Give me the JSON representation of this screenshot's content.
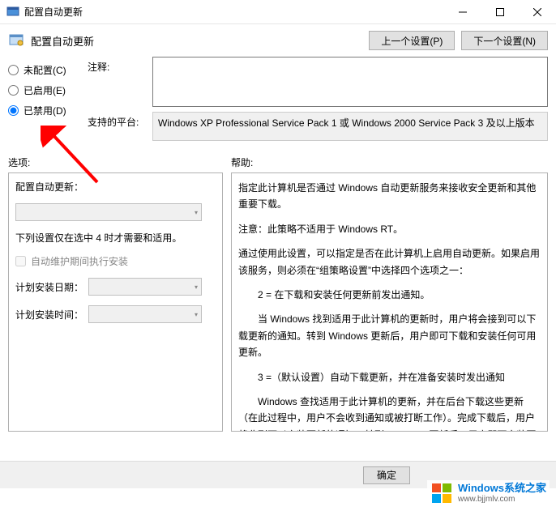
{
  "window": {
    "title": "配置自动更新"
  },
  "toolbar": {
    "title": "配置自动更新",
    "prev": "上一个设置(P)",
    "next": "下一个设置(N)"
  },
  "radios": {
    "not_configured": "未配置(C)",
    "enabled": "已启用(E)",
    "disabled": "已禁用(D)",
    "selected": "disabled"
  },
  "form": {
    "comment_label": "注释:",
    "comment_value": "",
    "platform_label": "支持的平台:",
    "platform_value": "Windows XP Professional Service Pack 1 或 Windows 2000 Service Pack 3 及以上版本"
  },
  "section": {
    "options_label": "选项:",
    "help_label": "帮助:"
  },
  "options": {
    "heading": "配置自动更新：",
    "note": "下列设置仅在选中 4 时才需要和适用。",
    "maintenance_chk": "自动维护期间执行安装",
    "sched_date": "计划安装日期：",
    "sched_time": "计划安装时间："
  },
  "help": {
    "p1": "指定此计算机是否通过 Windows 自动更新服务来接收安全更新和其他重要下载。",
    "p2": "注意：此策略不适用于 Windows RT。",
    "p3": "通过使用此设置，可以指定是否在此计算机上启用自动更新。如果启用该服务，则必须在“组策略设置”中选择四个选项之一：",
    "p4": "2 = 在下载和安装任何更新前发出通知。",
    "p5": "当 Windows 找到适用于此计算机的更新时，用户将会接到可以下载更新的通知。转到 Windows 更新后，用户即可下载和安装任何可用更新。",
    "p6": "3 =（默认设置）自动下载更新，并在准备安装时发出通知",
    "p7": "Windows 查找适用于此计算机的更新，并在后台下载这些更新（在此过程中，用户不会收到通知或被打断工作）。完成下载后，用户将收到可以安装更新的通知。转到 Windows 更新后，用户即可安装更新。"
  },
  "buttons": {
    "ok": "确定"
  },
  "watermark": {
    "brand": "Windows",
    "cn": "系统之家",
    "url": "www.bjjmlv.com"
  }
}
